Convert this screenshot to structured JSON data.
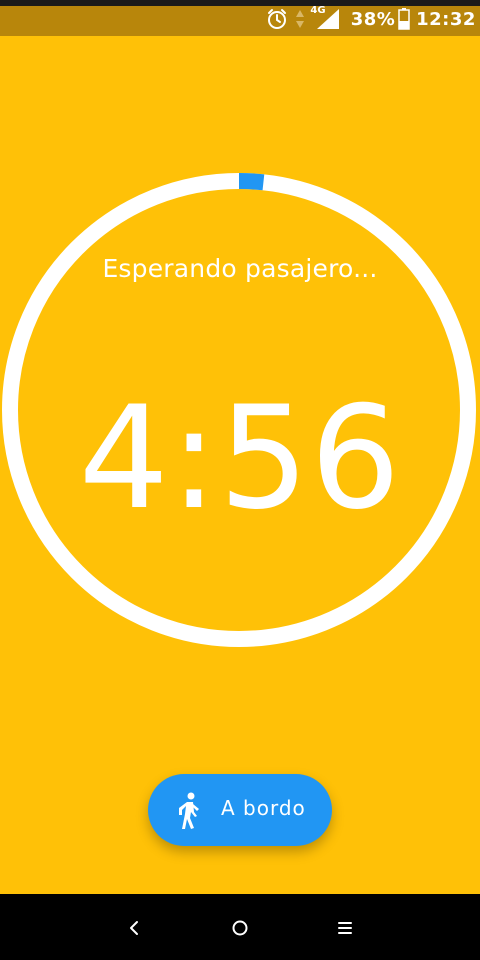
{
  "status_bar": {
    "network": "4G",
    "battery": "38%",
    "time": "12:32",
    "icons": [
      "alarm-icon",
      "data-arrows-icon",
      "signal-icon",
      "battery-icon"
    ]
  },
  "ride": {
    "status": "Esperando pasajero...",
    "countdown": "4:56",
    "progress_fraction": 0.017
  },
  "fab": {
    "icon": "walking-person-icon",
    "label": "A bordo"
  },
  "nav": {
    "back": "back-icon",
    "home": "home-icon",
    "recents": "recents-icon"
  },
  "colors": {
    "background": "#FFC107",
    "status_bar": "#B8860B",
    "accent": "#2196F3",
    "ring": "#FFFFFF"
  }
}
